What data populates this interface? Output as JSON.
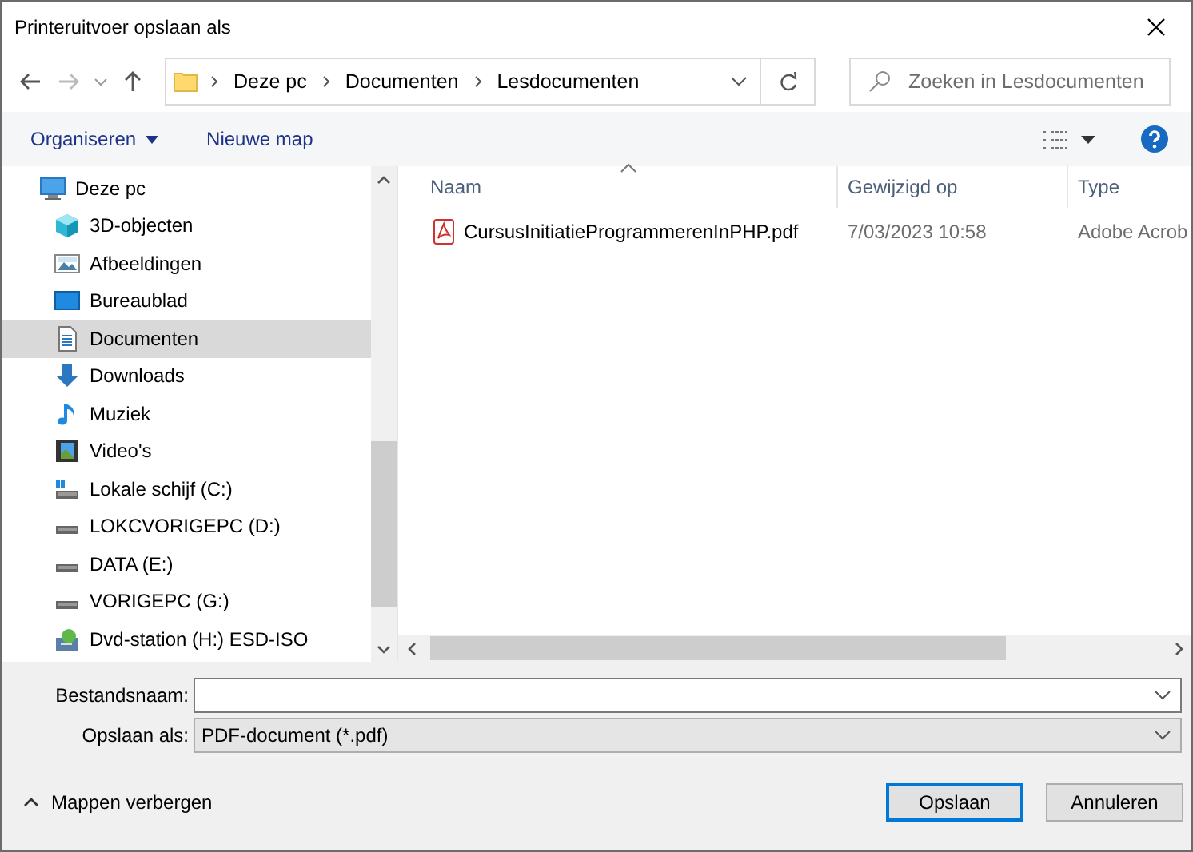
{
  "window": {
    "title": "Printeruitvoer opslaan als"
  },
  "breadcrumb": [
    "Deze pc",
    "Documenten",
    "Lesdocumenten"
  ],
  "search": {
    "placeholder": "Zoeken in Lesdocumenten"
  },
  "toolbar": {
    "organize": "Organiseren",
    "new_folder": "Nieuwe map"
  },
  "sidebar": {
    "items": [
      {
        "label": "Deze pc",
        "kind": "pc",
        "selected": false,
        "children": [
          {
            "label": "3D-objecten",
            "kind": "cube",
            "selected": false
          },
          {
            "label": "Afbeeldingen",
            "kind": "pictures",
            "selected": false
          },
          {
            "label": "Bureaublad",
            "kind": "desktop",
            "selected": false
          },
          {
            "label": "Documenten",
            "kind": "documents",
            "selected": true
          },
          {
            "label": "Downloads",
            "kind": "downloads",
            "selected": false
          },
          {
            "label": "Muziek",
            "kind": "music",
            "selected": false
          },
          {
            "label": "Video's",
            "kind": "videos",
            "selected": false
          },
          {
            "label": "Lokale schijf (C:)",
            "kind": "system-drive",
            "selected": false
          },
          {
            "label": "LOKCVORIGEPC (D:)",
            "kind": "drive",
            "selected": false
          },
          {
            "label": "DATA (E:)",
            "kind": "drive",
            "selected": false
          },
          {
            "label": "VORIGEPC (G:)",
            "kind": "drive",
            "selected": false
          },
          {
            "label": "Dvd-station (H:) ESD-ISO",
            "kind": "dvd",
            "selected": false
          }
        ]
      }
    ]
  },
  "files": {
    "columns": [
      "Naam",
      "Gewijzigd op",
      "Type"
    ],
    "rows": [
      {
        "name": "CursusInitiatieProgrammerenInPHP.pdf",
        "modified": "7/03/2023 10:58",
        "type": "Adobe Acrob"
      }
    ]
  },
  "form": {
    "filename_label": "Bestandsnaam:",
    "type_label": "Opslaan als:",
    "type_value": "PDF-document (*.pdf)"
  },
  "hide_folders": "Mappen verbergen",
  "buttons": [
    {
      "label": "Opslaan",
      "default": true
    },
    {
      "label": "Annuleren",
      "default": false
    }
  ]
}
